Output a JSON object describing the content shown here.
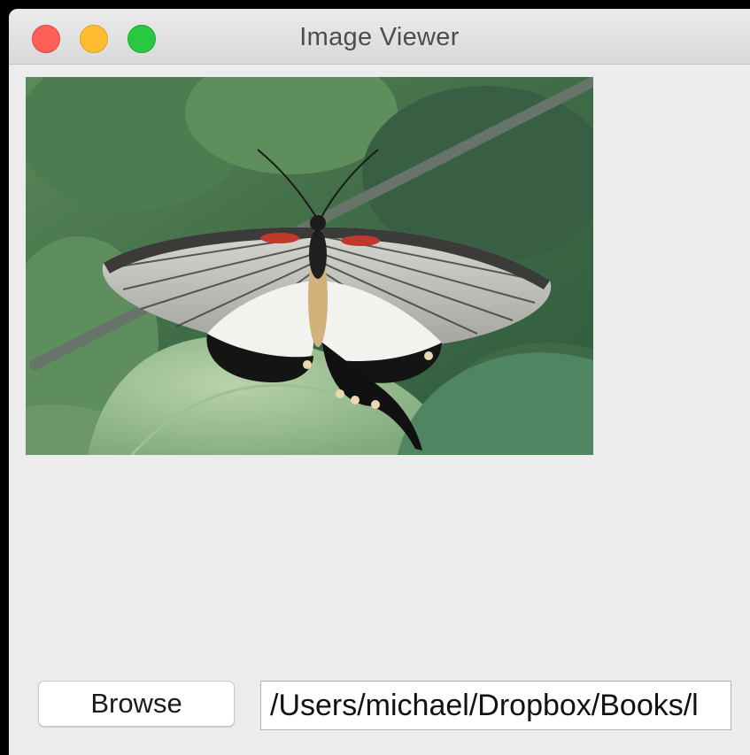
{
  "window": {
    "title": "Image Viewer"
  },
  "traffic_lights": {
    "close_color": "#fe5f57",
    "minimize_color": "#febc2e",
    "zoom_color": "#28c840"
  },
  "image": {
    "subject": "butterfly on leaf"
  },
  "controls": {
    "browse_label": "Browse",
    "path_value": "/Users/michael/Dropbox/Books/l"
  }
}
